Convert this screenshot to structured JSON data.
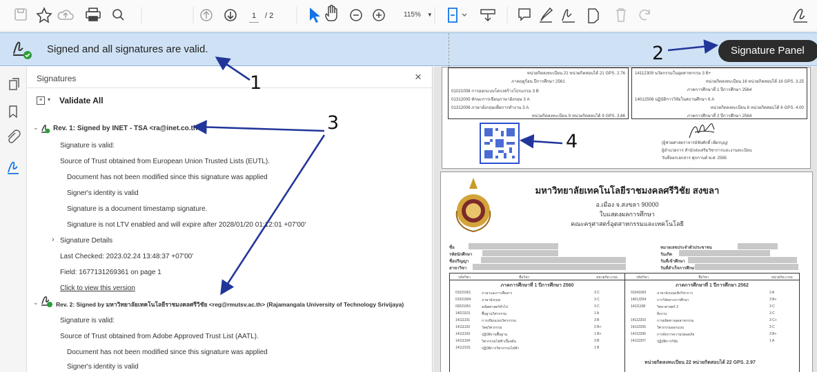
{
  "toolbar": {
    "page_current": "1",
    "page_total": "/ 2",
    "zoom": "115%"
  },
  "banner": {
    "message": "Signed and all signatures are valid.",
    "panel_button": "Signature Panel"
  },
  "signatures": {
    "title": "Signatures",
    "validate_all": "Validate All",
    "rev1": {
      "title": "Rev. 1: Signed by INET - TSA <ra@inet.co.th>",
      "items": [
        "Signature is valid:",
        "Source of Trust obtained from European Union Trusted Lists (EUTL).",
        "Document has not been modified since this signature was applied",
        "Signer's identity is valid",
        "Signature is a document timestamp signature.",
        "Signature is not LTV enabled and will expire after 2028/01/20 01:12:01 +07'00'"
      ],
      "details": "Signature Details",
      "last_checked": "Last Checked: 2023.02.24 13:48:37 +07'00'",
      "field": "Field: 1677131269361 on page 1",
      "click": "Click to view this version"
    },
    "rev2": {
      "title": "Rev. 2: Signed by มหาวิทยาลัยเทคโนโลยีราชมงคลศรีวิชัย <reg@rmutsv.ac.th> (Rajamangala University of Technology Srivijaya)",
      "items": [
        "Signature is valid:",
        "Source of Trust obtained from Adobe Approved Trust List (AATL).",
        "Document has not been modified since this signature was applied",
        "Signer's identity is valid"
      ]
    }
  },
  "annotations": {
    "a1": "1",
    "a2": "2",
    "a3": "3",
    "a4": "4"
  },
  "doc_top": {
    "left_lines": [
      "หน่วยกิตลงทะเบียน 21 หน่วยกิตสอบได้ 21 GPS. 2.76",
      "ภาคฤดูร้อน ปีการศึกษา 2561",
      "01021008 การออกแบบโครงสร้างโปรแกรม 3 B",
      "01312005 ทักษะการเขียนภาษาอังกฤษ 3 A",
      "01312006 ภาษาอังกฤษเพื่อการทำงาน 3 A",
      "หน่วยกิตลงทะเบียน 9 หน่วยกิตสอบได้ 9 GPS. 3.66"
    ],
    "right_lines": [
      "14112309 นวัตกรรมในอุตสาหกรรม 3 B+",
      "หน่วยกิตลงทะเบียน 16 หน่วยกิตสอบได้ 16 GPS. 3.25",
      "ภาคการศึกษาที่ 1 ปีการศึกษา 2564",
      "14012506 ปฏิบัติการวิจัยในสถานศึกษา 6 A",
      "หน่วยกิตลงทะเบียน 6 หน่วยกิตสอบได้ 6 GPS. 4.00",
      "ภาคการศึกษาที่ 2 ปีการศึกษา 2564"
    ],
    "sig_caption": "(ผู้ช่วยศาสตราจารย์ชัยศักดิ์ เพียรบุญ)",
    "sig_role": "ผู้อำนวยการ สำนักส่งเสริมวิชาการและงานทะเบียน",
    "sig_date": "วันที่ออกเอกสาร ศุภกานต์ พ.ศ. 2565"
  },
  "doc_main": {
    "university": "มหาวิทยาลัยเทคโนโลยีราชมงคลศรีวิชัย สงขลา",
    "address": "อ.เมือง จ.สงขลา 90000",
    "doc_type": "ใบแสดงผลการศึกษา",
    "faculty": "คณะครุศาสตร์อุตสาหกรรมและเทคโนโลยี",
    "left_fields": [
      "ชื่อ",
      "รหัสนักศึกษา",
      "ชื่อปริญญา",
      "สาขาวิชา"
    ],
    "right_fields": [
      "หมายเลขประจำตัวประชาชน",
      "วันเกิด",
      "วันที่เข้าศึกษา",
      "วันที่สำเร็จการศึกษา"
    ],
    "col_headers": [
      "รหัสวิชา",
      "ชื่อวิชา",
      "หน่วยกิต เกรด",
      "รหัสวิชา",
      "ชื่อวิชา",
      "หน่วยกิต เกรด"
    ],
    "sem_left": "ภาคการศึกษาที่ 1 ปีการศึกษา 2560",
    "sem_right": "ภาคการศึกษาที่ 1 ปีการศึกษา 2562",
    "rows_left": [
      [
        "01021001",
        "ภาษาและการสื่อสาร",
        "3 C"
      ],
      [
        "01021004",
        "ภาษาอังกฤษ",
        "3 C"
      ],
      [
        "02021001",
        "คณิตศาสตร์ทั่วไป",
        "3 C"
      ],
      [
        "14011101",
        "พื้นฐานวิศวกรรม",
        "1 A"
      ],
      [
        "14111101",
        "การเขียนแบบวิศวกรรม",
        "3 B"
      ],
      [
        "14111102",
        "วัสดุวิศวกรรม",
        "2 B+"
      ],
      [
        "14111103",
        "ปฏิบัติงานพื้นฐาน",
        "1 B+"
      ],
      [
        "14111104",
        "วิศวกรรมไฟฟ้าเบื้องต้น",
        "3 B"
      ],
      [
        "14112101",
        "ปฏิบัติการวิศวกรรมไฟฟ้า",
        "1 B"
      ]
    ],
    "rows_right": [
      [
        "01041003",
        "ภาษาอังกฤษเชิงวิชาการ",
        "3 A"
      ],
      [
        "14012204",
        "การวิจัยทางการศึกษา",
        "3 B+"
      ],
      [
        "14111108",
        "วิทยาศาสตร์ 2",
        "3 C"
      ],
      [
        "",
        "สิ่งงาน",
        "3 C"
      ],
      [
        "14112203",
        "การผลิตทางอุตสาหกรรม",
        "3 C+"
      ],
      [
        "14112205",
        "วิศวกรรมออกแบบ",
        "3 C"
      ],
      [
        "14112206",
        "การจัดการความปลอดภัย",
        "3 B+"
      ],
      [
        "14112207",
        "ปฏิบัติการวิจัย",
        "1 A"
      ]
    ],
    "summary_right": "หน่วยกิตลงทะเบียน 22 หน่วยกิตสอบได้ 22 GPS. 2.97"
  }
}
